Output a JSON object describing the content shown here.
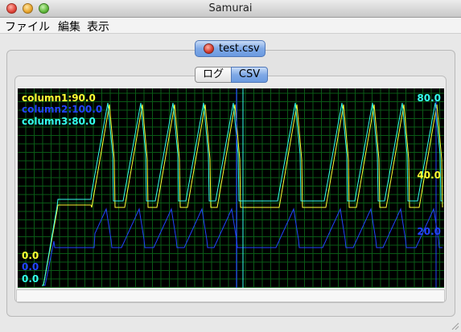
{
  "window": {
    "title": "Samurai"
  },
  "menu": [
    "ファイル",
    "編集",
    "表示"
  ],
  "file_tab": {
    "label": "test.csv"
  },
  "view_tabs": [
    {
      "label": "ログ",
      "selected": false
    },
    {
      "label": "CSV",
      "selected": true
    }
  ],
  "chart_data": {
    "type": "line",
    "series": [
      {
        "name": "column1",
        "color": "#ffff33",
        "legend": "column1:90.0",
        "min_label": "0.0",
        "max_label": "40.0"
      },
      {
        "name": "column2",
        "color": "#2244ff",
        "legend": "column2:100.0",
        "min_label": "0.0",
        "max_label": "20.0"
      },
      {
        "name": "column3",
        "color": "#33ffee",
        "legend": "column3:80.0",
        "min_label": "0.0",
        "max_label": "80.0"
      }
    ],
    "grid": true,
    "background": "#000000",
    "grid_color": "#0a5a16"
  }
}
